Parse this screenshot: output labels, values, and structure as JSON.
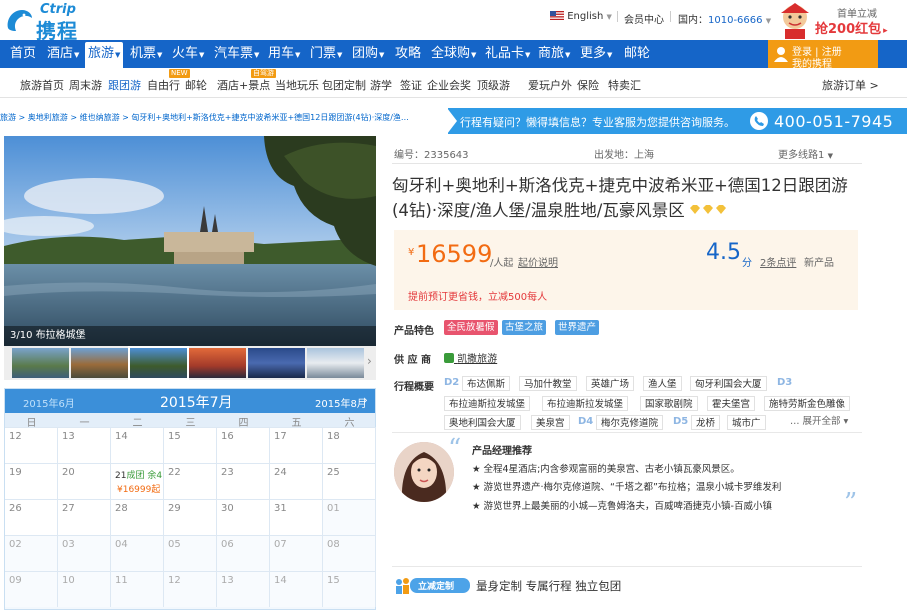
{
  "header": {
    "brand_en": "Ctrip",
    "brand_cn": "携程",
    "language": "English",
    "language_arrow": "▼",
    "member_center": "会员中心",
    "domestic_phone_label": "国内：",
    "domestic_phone": "1010-6666",
    "phone_arrow": "▼",
    "promo_line1": "首单立减",
    "promo_line2": "抢200红包",
    "promo_arrow": "▸"
  },
  "main_nav": [
    {
      "label": "首页",
      "active": false,
      "arrow": false
    },
    {
      "label": "酒店",
      "active": false,
      "arrow": true
    },
    {
      "label": "旅游",
      "active": true,
      "arrow": true
    },
    {
      "label": "机票",
      "active": false,
      "arrow": true
    },
    {
      "label": "火车",
      "active": false,
      "arrow": true
    },
    {
      "label": "汽车票",
      "active": false,
      "arrow": true
    },
    {
      "label": "用车",
      "active": false,
      "arrow": true
    },
    {
      "label": "门票",
      "active": false,
      "arrow": true
    },
    {
      "label": "团购",
      "active": false,
      "arrow": true
    },
    {
      "label": "攻略",
      "active": false,
      "arrow": false
    },
    {
      "label": "全球购",
      "active": false,
      "arrow": true
    },
    {
      "label": "礼品卡",
      "active": false,
      "arrow": true
    },
    {
      "label": "商旅",
      "active": false,
      "arrow": true
    },
    {
      "label": "更多",
      "active": false,
      "arrow": true
    },
    {
      "label": "邮轮",
      "active": false,
      "arrow": false
    }
  ],
  "login": {
    "line1": "登录 | 注册",
    "line2": "我的携程"
  },
  "sub_nav": [
    {
      "label": "旅游首页"
    },
    {
      "label": "周末游"
    },
    {
      "label": "跟团游",
      "current": true
    },
    {
      "label": "自由行",
      "badge": "NEW"
    },
    {
      "label": "邮轮"
    },
    {
      "label": "酒店+景点",
      "badge": "自驾游"
    },
    {
      "label": "当地玩乐"
    },
    {
      "label": "包团定制"
    },
    {
      "label": "游学"
    },
    {
      "label": "签证"
    },
    {
      "label": "企业会奖"
    },
    {
      "label": "顶级游"
    },
    {
      "label": "爱玩户外"
    },
    {
      "label": "保险"
    },
    {
      "label": "特卖汇"
    }
  ],
  "orders_link": "旅游订单 >",
  "breadcrumb": "旅游 > 奥地利旅游 > 维也纳旅游 > 匈牙利+奥地利+斯洛伐克+捷克中波希米亚+德国12日跟团游(4钻)·深度/渔…",
  "help": {
    "text": "行程有疑问？懒得填信息？专业客服为您提供咨询服务。",
    "phone": "400-051-7945"
  },
  "photo_caption": "3/10 布拉格城堡",
  "calendar": {
    "prev_month": "2015年6月",
    "current_month": "2015年7月",
    "next_month": "2015年8月",
    "next_arrow": "›",
    "weekdays": [
      "日",
      "一",
      "二",
      "三",
      "四",
      "五",
      "六"
    ],
    "rows": [
      [
        "12",
        "13",
        "14",
        "15",
        "16",
        "17",
        "18"
      ],
      [
        "19",
        "20",
        "21",
        "22",
        "23",
        "24",
        "25"
      ],
      [
        "26",
        "27",
        "28",
        "29",
        "30",
        "31",
        "01"
      ],
      [
        "02",
        "03",
        "04",
        "05",
        "06",
        "07",
        "08"
      ],
      [
        "09",
        "10",
        "11",
        "12",
        "13",
        "14",
        "15"
      ]
    ],
    "departure": {
      "date": "21",
      "status": "成团 余4",
      "price": "¥16999起"
    }
  },
  "product": {
    "number_label": "编号：",
    "number": "2335643",
    "depart_label": "出发地：",
    "depart_city": "上海",
    "more_routes": "更多线路1",
    "title": "匈牙利+奥地利+斯洛伐克+捷克中波希米亚+德国12日跟团游(4钻)·深度/渔人堡/温泉胜地/瓦豪风景区",
    "price_symbol": "¥",
    "price": "16599",
    "price_unit": "/人起",
    "price_desc": "起价说明",
    "score": "4.5",
    "score_unit": "分",
    "reviews": "2条点评",
    "new_product": "新产品",
    "promo": "提前预订更省钱，立减500每人",
    "features_label": "产品特色",
    "features": [
      {
        "label": "全民放暑假",
        "color": "#e8546e"
      },
      {
        "label": "古堡之旅",
        "color": "#4d9ee2"
      },
      {
        "label": "世界遗产",
        "color": "#4d9ee2"
      }
    ],
    "supplier_label": "供 应 商",
    "supplier": "凯撒旅游",
    "itinerary_label": "行程概要",
    "itinerary": [
      [
        {
          "d": "D2"
        },
        {
          "c": "布达佩斯"
        },
        {
          "c": "马加什教堂"
        },
        {
          "c": "英雄广场"
        },
        {
          "c": "渔人堡"
        },
        {
          "c": "匈牙利国会大厦"
        },
        {
          "d": "D3"
        }
      ],
      [
        {
          "c": "布拉迪斯拉发城堡"
        },
        {
          "c": "布拉迪斯拉发城堡"
        },
        {
          "c": "国家歌剧院"
        },
        {
          "c": "霍夫堡宫"
        },
        {
          "c": "施特劳斯金色雕像"
        }
      ],
      [
        {
          "c": "奥地利国会大厦"
        },
        {
          "c": "美泉宫"
        },
        {
          "d": "D4"
        },
        {
          "c": "梅尔克修道院"
        },
        {
          "d": "D5"
        },
        {
          "c": "龙桥"
        },
        {
          "c": "城市广"
        }
      ]
    ],
    "expand_all": "… 展开全部 ▾"
  },
  "manager": {
    "title": "产品经理推荐",
    "lines": [
      "★ 全程4星酒店;内含参观富丽的美泉宫、古老小镇瓦豪风景区。",
      "★ 游览世界遗产·梅尔克修道院、“千塔之都”布拉格；温泉小城卡罗维发利",
      "★ 游览世界上最美丽的小城—克鲁姆洛夫，百威啤酒捷克小镇-百威小镇"
    ]
  },
  "custom": {
    "badge": "立减定制",
    "text": "量身定制 专属行程 独立包团"
  }
}
